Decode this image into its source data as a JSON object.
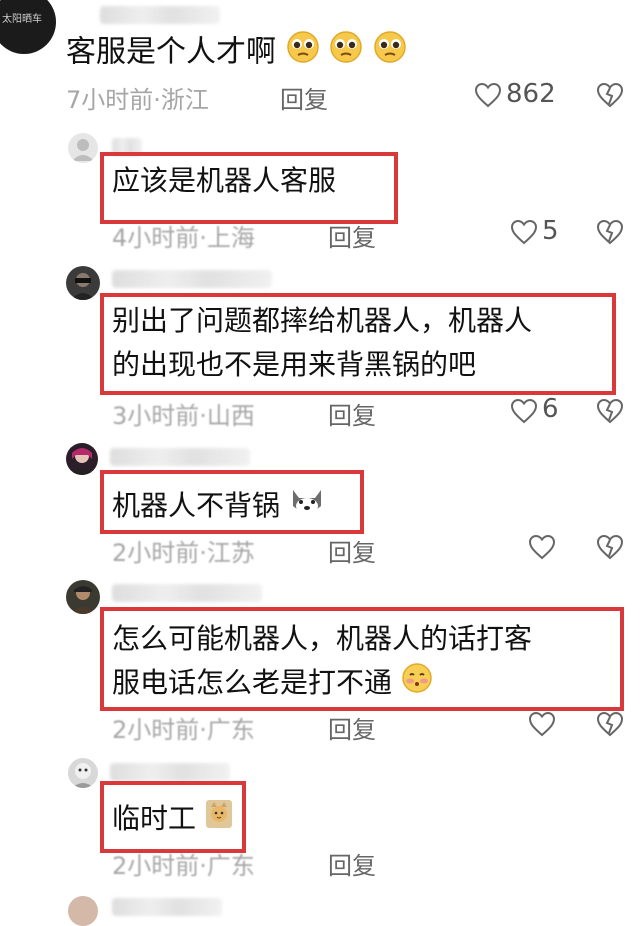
{
  "comments": [
    {
      "text": "客服是个人才啊",
      "time": "7小时前",
      "location": "浙江",
      "reply_label": "回复",
      "likes": "862",
      "emojis": [
        "pleading-face-emoji",
        "pleading-face-emoji",
        "pleading-face-emoji"
      ],
      "avatar_text": "太阳晒车"
    },
    {
      "text": "应该是机器人客服",
      "time": "4小时前",
      "location": "上海",
      "reply_label": "回复",
      "likes": "5"
    },
    {
      "text_line1": "别出了问题都摔给机器人，机器人",
      "text_line2": "的出现也不是用来背黑锅的吧",
      "time": "3小时前",
      "location": "山西",
      "reply_label": "回复",
      "likes": "6"
    },
    {
      "text": "机器人不背锅",
      "time": "2小时前",
      "location": "江苏",
      "reply_label": "回复",
      "emojis": [
        "husky-dog-emoji"
      ]
    },
    {
      "text_line1": "怎么可能机器人，机器人的话打客",
      "text_line2": "服电话怎么老是打不通",
      "time": "2小时前",
      "location": "广东",
      "reply_label": "回复",
      "emojis": [
        "shy-face-emoji"
      ]
    },
    {
      "text": "临时工",
      "time": "2小时前",
      "location": "广东",
      "reply_label": "回复",
      "emojis": [
        "cat-sticker-emoji"
      ]
    }
  ],
  "separator": "·",
  "colors": {
    "highlight_border": "#d9393b",
    "meta_text": "#a6a6a6",
    "background": "#ffffff"
  }
}
